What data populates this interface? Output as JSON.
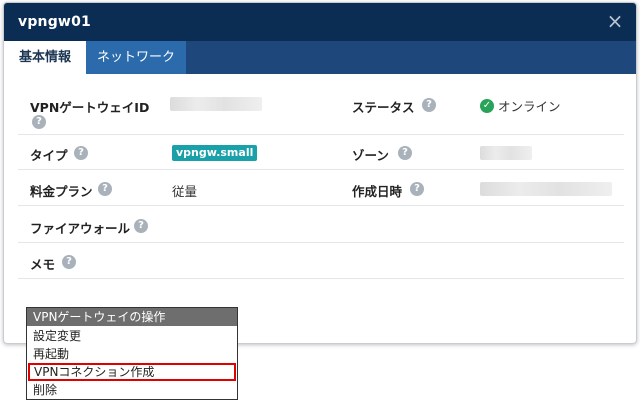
{
  "modal": {
    "title": "vpngw01",
    "close_symbol": "×"
  },
  "tabs": [
    {
      "label": "基本情報",
      "active": true
    },
    {
      "label": "ネットワーク",
      "active": false
    }
  ],
  "fields": {
    "vpn_gateway_id": {
      "label": "VPNゲートウェイID",
      "value": "[blurred]"
    },
    "status": {
      "label": "ステータス",
      "value": "オンライン"
    },
    "type": {
      "label": "タイプ",
      "value": "vpngw.small"
    },
    "zone": {
      "label": "ゾーン",
      "value": "[blurred]"
    },
    "pricing_plan": {
      "label": "料金プラン",
      "value": "従量"
    },
    "created_at": {
      "label": "作成日時",
      "value": "[blurred]"
    },
    "firewall": {
      "label": "ファイアウォール",
      "value": ""
    },
    "memo": {
      "label": "メモ",
      "value": ""
    }
  },
  "help_symbol": "?",
  "status_icon": "check-circle-icon",
  "colors": {
    "header_bg": "#0b2d53",
    "tabbar_bg": "#1e477c",
    "inactive_tab_bg": "#2b6aab",
    "badge_bg": "#1aa0a8",
    "status_ok": "#27a35a",
    "highlight_border": "#e00000"
  },
  "action_menu": {
    "title": "VPNゲートウェイの操作",
    "items": [
      {
        "label": "設定変更",
        "highlighted": false
      },
      {
        "label": "再起動",
        "highlighted": false
      },
      {
        "label": "VPNコネクション作成",
        "highlighted": true
      },
      {
        "label": "削除",
        "highlighted": false
      }
    ]
  }
}
